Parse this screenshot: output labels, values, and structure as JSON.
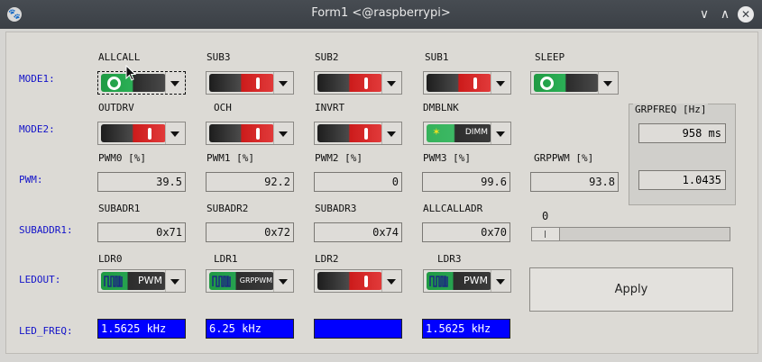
{
  "window": {
    "title": "Form1 <@raspberrypi>",
    "app_icon": "paw-icon",
    "buttons": {
      "minimize": "∨",
      "maximize": "∧",
      "close": "✕"
    }
  },
  "rows": {
    "mode1": "MODE1:",
    "mode2": "MODE2:",
    "pwm": "PWM:",
    "subaddr1": "SUBADDR1:",
    "ledout": "LEDOUT:",
    "led_freq": "LED_FREQ:"
  },
  "mode1": [
    {
      "label": "ALLCALL",
      "state": "on"
    },
    {
      "label": "SUB3",
      "state": "off"
    },
    {
      "label": "SUB2",
      "state": "off"
    },
    {
      "label": "SUB1",
      "state": "off"
    },
    {
      "label": "SLEEP",
      "state": "on"
    }
  ],
  "mode2": [
    {
      "label": "OUTDRV",
      "state": "off"
    },
    {
      "label": "OCH",
      "state": "off"
    },
    {
      "label": "INVRT",
      "state": "off"
    },
    {
      "label": "DMBLNK",
      "state": "dimm",
      "text": "DIMM"
    }
  ],
  "pwm": [
    {
      "label": "PWM0 [%]",
      "value": "39.5"
    },
    {
      "label": "PWM1 [%]",
      "value": "92.2"
    },
    {
      "label": "PWM2 [%]",
      "value": "0"
    },
    {
      "label": "PWM3 [%]",
      "value": "99.6"
    },
    {
      "label": "GRPPWM [%]",
      "value": "93.8"
    }
  ],
  "subaddr": [
    {
      "label": "SUBADR1",
      "value": "0x71"
    },
    {
      "label": "SUBADR2",
      "value": "0x72"
    },
    {
      "label": "SUBADR3",
      "value": "0x74"
    },
    {
      "label": "ALLCALLADR",
      "value": "0x70"
    }
  ],
  "ledout": [
    {
      "label": "LDR0",
      "text": "PWM"
    },
    {
      "label": "LDR1",
      "text": "GRPPWM"
    },
    {
      "label": "LDR2",
      "text": ""
    },
    {
      "label": "LDR3",
      "text": "PWM"
    }
  ],
  "led_freq": [
    "1.5625 kHz",
    "6.25 kHz",
    "",
    "1.5625 kHz"
  ],
  "grpfreq": {
    "title": "GRPFREQ [Hz]",
    "period": "958 ms",
    "value": "1.0435"
  },
  "slider": {
    "value_label": "0",
    "value": 0
  },
  "apply_label": "Apply"
}
